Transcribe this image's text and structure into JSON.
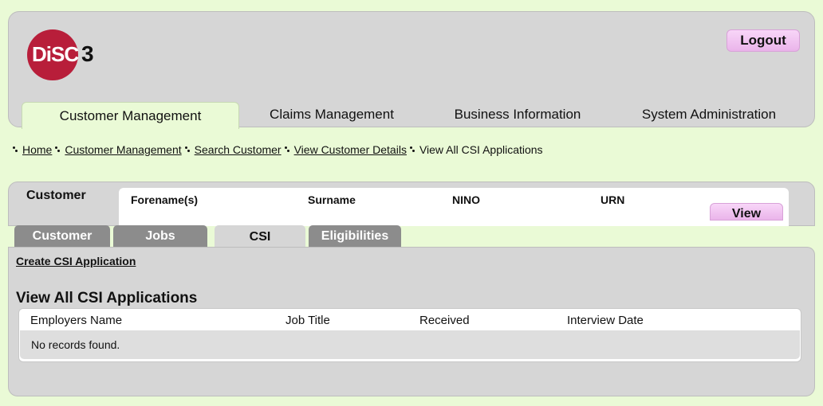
{
  "logo": {
    "text": "DiSC",
    "number": "3"
  },
  "header": {
    "logout_label": "Logout"
  },
  "main_tabs": [
    {
      "label": "Customer Management",
      "active": true
    },
    {
      "label": "Claims Management",
      "active": false
    },
    {
      "label": "Business Information",
      "active": false
    },
    {
      "label": "System Administration",
      "active": false
    }
  ],
  "breadcrumb": {
    "items": [
      "Home",
      "Customer Management",
      "Search Customer",
      "View Customer Details"
    ],
    "current": "View All CSI Applications"
  },
  "customer_panel": {
    "label": "Customer",
    "columns": [
      "Forename(s)",
      "Surname",
      "NINO",
      "URN"
    ],
    "view_button": "View"
  },
  "sub_tabs": [
    {
      "label": "Customer",
      "active": false
    },
    {
      "label": "Jobs",
      "active": false
    },
    {
      "label": "CSI",
      "active": true
    },
    {
      "label": "Eligibilities",
      "active": false
    }
  ],
  "content": {
    "create_link": "Create CSI Application",
    "section_title": "View All CSI Applications",
    "table_headers": [
      "Employers Name",
      "Job Title",
      "Received",
      "Interview Date"
    ],
    "empty_message": "No records found."
  },
  "colors": {
    "background": "#eafad6",
    "panel": "#d6d6d6",
    "logo": "#b81e3a",
    "button": "#eab4ea",
    "inactive_tab": "#8c8c8c"
  }
}
